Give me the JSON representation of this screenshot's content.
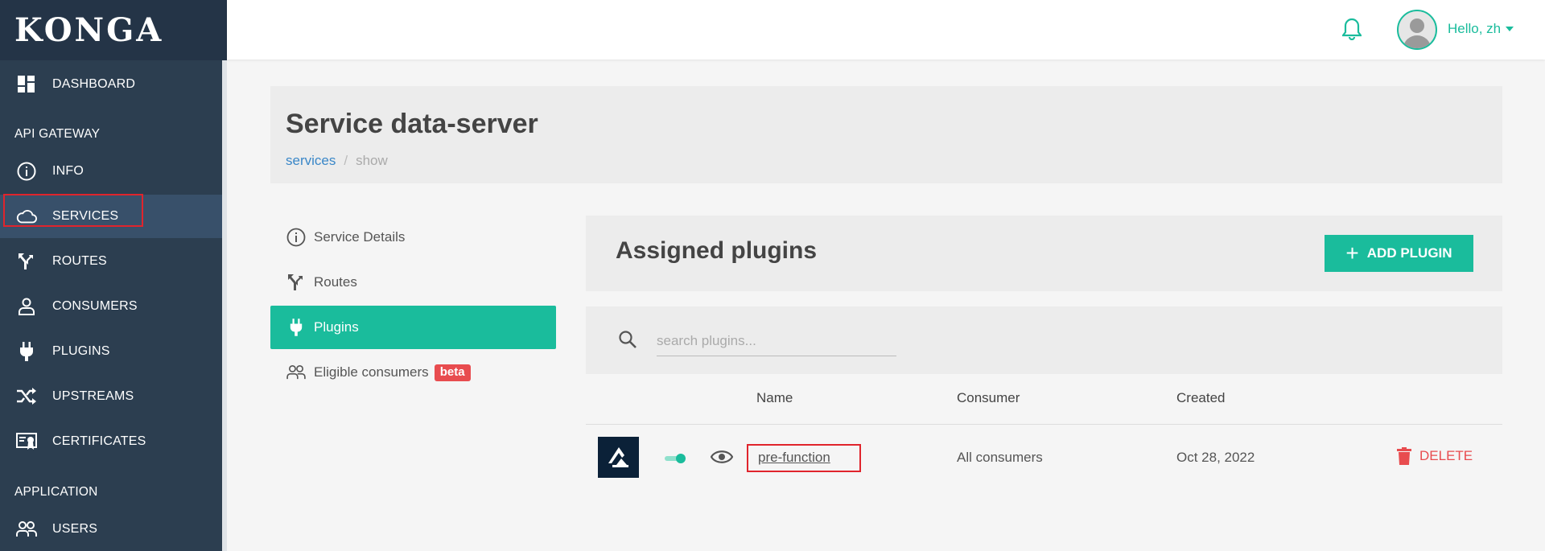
{
  "app": {
    "logo": "KONGA"
  },
  "sidebar": {
    "dashboard": "DASHBOARD",
    "section_api_gateway": "API GATEWAY",
    "items": [
      {
        "label": "INFO",
        "icon": "info-icon"
      },
      {
        "label": "SERVICES",
        "icon": "cloud-icon"
      },
      {
        "label": "ROUTES",
        "icon": "routes-icon"
      },
      {
        "label": "CONSUMERS",
        "icon": "user-icon"
      },
      {
        "label": "PLUGINS",
        "icon": "plug-icon"
      },
      {
        "label": "UPSTREAMS",
        "icon": "shuffle-icon"
      },
      {
        "label": "CERTIFICATES",
        "icon": "certificate-icon"
      }
    ],
    "section_application": "APPLICATION",
    "users": "USERS",
    "active": "SERVICES"
  },
  "topbar": {
    "greeting": "Hello, zh"
  },
  "page": {
    "title": "Service data-server",
    "breadcrumb": {
      "link": "services",
      "separator": "/",
      "current": "show"
    }
  },
  "subnav": {
    "items": [
      {
        "label": "Service Details",
        "icon": "info-icon"
      },
      {
        "label": "Routes",
        "icon": "routes-icon"
      },
      {
        "label": "Plugins",
        "icon": "plug-icon"
      },
      {
        "label": "Eligible consumers",
        "icon": "users-icon"
      }
    ],
    "beta_badge": "beta",
    "active": "Plugins"
  },
  "plugins_panel": {
    "title": "Assigned plugins",
    "add_button": "ADD PLUGIN",
    "search_placeholder": "search plugins...",
    "columns": {
      "name": "Name",
      "consumer": "Consumer",
      "created": "Created"
    },
    "rows": [
      {
        "name": "pre-function",
        "consumer": "All consumers",
        "created": "Oct 28, 2022",
        "enabled": true,
        "action": "DELETE"
      }
    ]
  },
  "colors": {
    "accent": "#1abc9c",
    "sidebar": "#2c3e50",
    "danger": "#e84c4f",
    "highlight": "#e0242c"
  }
}
